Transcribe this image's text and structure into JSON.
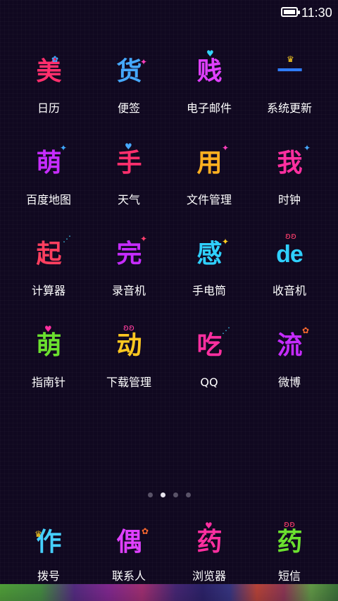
{
  "status_bar": {
    "time": "11:30",
    "battery_icon": "battery-full-icon"
  },
  "apps": [
    {
      "label": "日历",
      "glyph": "美",
      "color": "#ff2f6d",
      "deco": "✿",
      "deco_color": "#3fa8ff",
      "icon": "calendar-icon"
    },
    {
      "label": "便签",
      "glyph": "货",
      "color": "#46a9ff",
      "deco": "✦",
      "deco_color": "#ff3fbf",
      "icon": "notes-icon"
    },
    {
      "label": "电子邮件",
      "glyph": "贱",
      "color": "#e040ff",
      "deco": "♥",
      "deco_color": "#33d6ff",
      "icon": "email-icon"
    },
    {
      "label": "系统更新",
      "glyph": "一",
      "color": "#2f7dff",
      "deco": "♛",
      "deco_color": "#ffd020",
      "icon": "system-update-icon"
    },
    {
      "label": "百度地图",
      "glyph": "萌",
      "color": "#c62cff",
      "deco": "✦",
      "deco_color": "#3fa8ff",
      "icon": "baidu-map-icon"
    },
    {
      "label": "天气",
      "glyph": "手",
      "color": "#ff2f6d",
      "deco": "♥",
      "deco_color": "#46a9ff",
      "icon": "weather-icon"
    },
    {
      "label": "文件管理",
      "glyph": "用",
      "color": "#ffb020",
      "deco": "✦",
      "deco_color": "#ff3fbf",
      "icon": "file-manager-icon"
    },
    {
      "label": "时钟",
      "glyph": "我",
      "color": "#ff2fa0",
      "deco": "✦",
      "deco_color": "#46a9ff",
      "icon": "clock-icon"
    },
    {
      "label": "计算器",
      "glyph": "起",
      "color": "#ff3f5f",
      "deco": "⋰",
      "deco_color": "#3fd6ff",
      "icon": "calculator-icon"
    },
    {
      "label": "录音机",
      "glyph": "完",
      "color": "#c62cff",
      "deco": "✦",
      "deco_color": "#ff3f6d",
      "icon": "recorder-icon"
    },
    {
      "label": "手电筒",
      "glyph": "感",
      "color": "#2fd0ff",
      "deco": "✦",
      "deco_color": "#ffd020",
      "icon": "flashlight-icon"
    },
    {
      "label": "收音机",
      "glyph": "de",
      "color": "#2fd0ff",
      "deco": "ʚʚ",
      "deco_color": "#ff3f6d",
      "icon": "radio-icon"
    },
    {
      "label": "指南针",
      "glyph": "萌",
      "color": "#6be02f",
      "deco": "♥",
      "deco_color": "#ff2fa0",
      "icon": "compass-icon"
    },
    {
      "label": "下载管理",
      "glyph": "动",
      "color": "#ffc820",
      "deco": "ʚʚ",
      "deco_color": "#ff3f9f",
      "icon": "download-manager-icon"
    },
    {
      "label": "QQ",
      "glyph": "吃",
      "color": "#ff2fa0",
      "deco": "⋰",
      "deco_color": "#3fd6ff",
      "icon": "qq-icon"
    },
    {
      "label": "微博",
      "glyph": "流",
      "color": "#c62cff",
      "deco": "✿",
      "deco_color": "#ff6a2f",
      "icon": "weibo-icon"
    }
  ],
  "pager": {
    "count": 4,
    "active_index": 1
  },
  "dock": [
    {
      "label": "拨号",
      "glyph": "作",
      "color": "#46d0ff",
      "deco": "♛",
      "deco_color": "#ffd020",
      "icon": "dialer-icon"
    },
    {
      "label": "联系人",
      "glyph": "偶",
      "color": "#e040ff",
      "deco": "✿",
      "deco_color": "#ff6a2f",
      "icon": "contacts-icon"
    },
    {
      "label": "浏览器",
      "glyph": "药",
      "color": "#ff2fa0",
      "deco": "♥",
      "deco_color": "#ff2fa0",
      "icon": "browser-icon"
    },
    {
      "label": "短信",
      "glyph": "药",
      "color": "#6be02f",
      "deco": "ʚʚ",
      "deco_color": "#ff3f6d",
      "icon": "messages-icon"
    }
  ]
}
